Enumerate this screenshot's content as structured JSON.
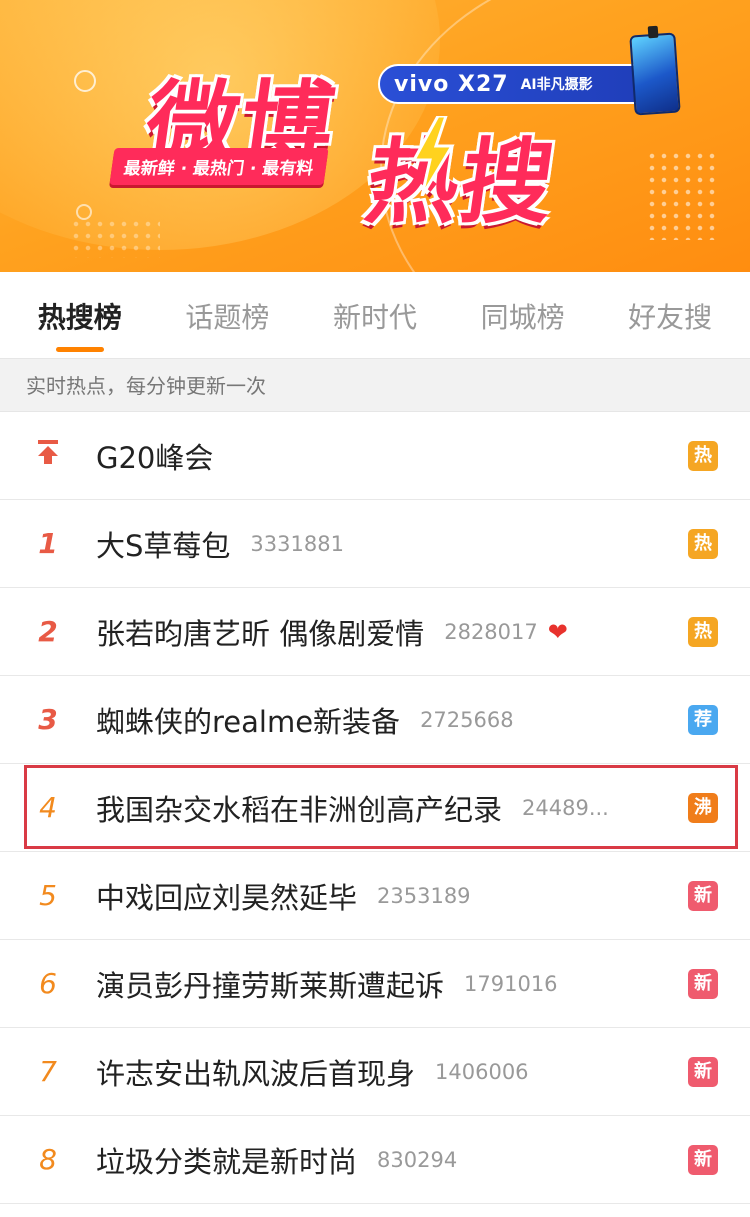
{
  "banner": {
    "title_line1": "微博",
    "title_line2": "热搜",
    "slogan": "最新鲜 · 最热门 · 最有料",
    "ad_brand": "vivo X27",
    "ad_tag": "AI非凡摄影"
  },
  "tabs": [
    {
      "label": "热搜榜",
      "active": true
    },
    {
      "label": "话题榜",
      "active": false
    },
    {
      "label": "新时代",
      "active": false
    },
    {
      "label": "同城榜",
      "active": false
    },
    {
      "label": "好友搜",
      "active": false
    }
  ],
  "subbar": {
    "text": "实时热点，每分钟更新一次"
  },
  "colors": {
    "accent": "#ff8200",
    "hot": "#f5a623",
    "recommend": "#4aa8f0",
    "boil": "#f07d1a",
    "new": "#ef5b6e",
    "highlight": "#d93a45"
  },
  "items": [
    {
      "rank": "",
      "icon": "pin-top-icon",
      "topic": "G20峰会",
      "count": "",
      "badge": "热",
      "badge_type": "hot"
    },
    {
      "rank": "1",
      "topic": "大S草莓包",
      "count": "3331881",
      "badge": "热",
      "badge_type": "hot"
    },
    {
      "rank": "2",
      "topic": "张若昀唐艺昕 偶像剧爱情",
      "count": "2828017",
      "extra_icon": "heart-icon",
      "badge": "热",
      "badge_type": "hot"
    },
    {
      "rank": "3",
      "topic": "蜘蛛侠的realme新装备",
      "count": "2725668",
      "badge": "荐",
      "badge_type": "recommend"
    },
    {
      "rank": "4",
      "topic": "我国杂交水稻在非洲创高产纪录",
      "count": "24489...",
      "badge": "沸",
      "badge_type": "boil",
      "highlighted": true
    },
    {
      "rank": "5",
      "topic": "中戏回应刘昊然延毕",
      "count": "2353189",
      "badge": "新",
      "badge_type": "new"
    },
    {
      "rank": "6",
      "topic": "演员彭丹撞劳斯莱斯遭起诉",
      "count": "1791016",
      "badge": "新",
      "badge_type": "new"
    },
    {
      "rank": "7",
      "topic": "许志安出轨风波后首现身",
      "count": "1406006",
      "badge": "新",
      "badge_type": "new"
    },
    {
      "rank": "8",
      "topic": "垃圾分类就是新时尚",
      "count": "830294",
      "badge": "新",
      "badge_type": "new"
    }
  ]
}
